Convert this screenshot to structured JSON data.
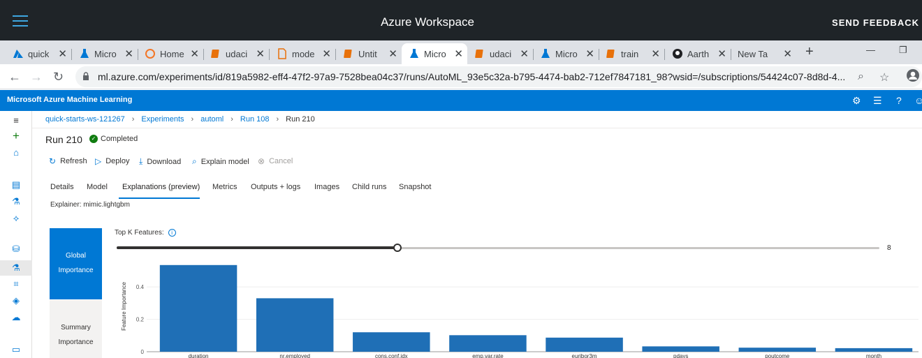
{
  "app": {
    "title": "Azure Workspace",
    "send_feedback": "SEND FEEDBACK"
  },
  "browser": {
    "tabs": [
      {
        "label": "quick",
        "icon": "azure-icon",
        "color": "#0078d4"
      },
      {
        "label": "Micro",
        "icon": "flask-icon",
        "color": "#0078d4"
      },
      {
        "label": "Home",
        "icon": "jupyter-icon",
        "color": "#f37626"
      },
      {
        "label": "udaci",
        "icon": "notebook-icon",
        "color": "#e8710a"
      },
      {
        "label": "mode",
        "icon": "file-icon",
        "color": "#e8710a"
      },
      {
        "label": "Untit",
        "icon": "notebook-icon",
        "color": "#e8710a"
      },
      {
        "label": "Micro",
        "icon": "flask-icon",
        "color": "#0078d4"
      },
      {
        "label": "udaci",
        "icon": "notebook-icon",
        "color": "#e8710a"
      },
      {
        "label": "Micro",
        "icon": "flask-icon",
        "color": "#0078d4"
      },
      {
        "label": "train",
        "icon": "notebook-icon",
        "color": "#e8710a"
      },
      {
        "label": "Aarth",
        "icon": "github-icon",
        "color": "#202124"
      },
      {
        "label": "New Tab",
        "icon": "none",
        "color": "#202124"
      }
    ],
    "url": "ml.azure.com/experiments/id/819a5982-eff4-47f2-97a9-7528bea04c37/runs/AutoML_93e5c32a-b795-4474-bab2-712ef7847181_98?wsid=/subscriptions/54424c07-8d8d-4..."
  },
  "ml": {
    "header_title": "Microsoft Azure Machine Learning",
    "breadcrumb": [
      "quick-starts-ws-121267",
      "Experiments",
      "automl",
      "Run 108",
      "Run 210"
    ],
    "run_title": "Run 210",
    "status": "Completed",
    "actions": {
      "refresh": "Refresh",
      "deploy": "Deploy",
      "download": "Download",
      "explain": "Explain model",
      "cancel": "Cancel"
    },
    "tabs": [
      "Details",
      "Model",
      "Explanations (preview)",
      "Metrics",
      "Outputs + logs",
      "Images",
      "Child runs",
      "Snapshot"
    ],
    "active_tab": "Explanations (preview)",
    "explainer": "Explainer: mimic.lightgbm",
    "importance": {
      "global_line1": "Global",
      "global_line2": "Importance",
      "summary_line1": "Summary",
      "summary_line2": "Importance"
    },
    "topk": {
      "label": "Top K Features:",
      "value": "8",
      "fraction": 0.368
    }
  },
  "chart_data": {
    "type": "bar",
    "ylabel": "Feature Importance",
    "categories": [
      "duration",
      "nr.employed",
      "cons.conf.idx",
      "emp.var.rate",
      "euribor3m",
      "pdays",
      "poutcome",
      "month"
    ],
    "values": [
      0.535,
      0.33,
      0.12,
      0.102,
      0.087,
      0.033,
      0.025,
      0.022
    ],
    "yticks": [
      "0",
      "0.2",
      "0.4"
    ],
    "ylim": [
      0,
      0.56
    ],
    "bar_color": "#1f6fb6",
    "grid": true
  }
}
